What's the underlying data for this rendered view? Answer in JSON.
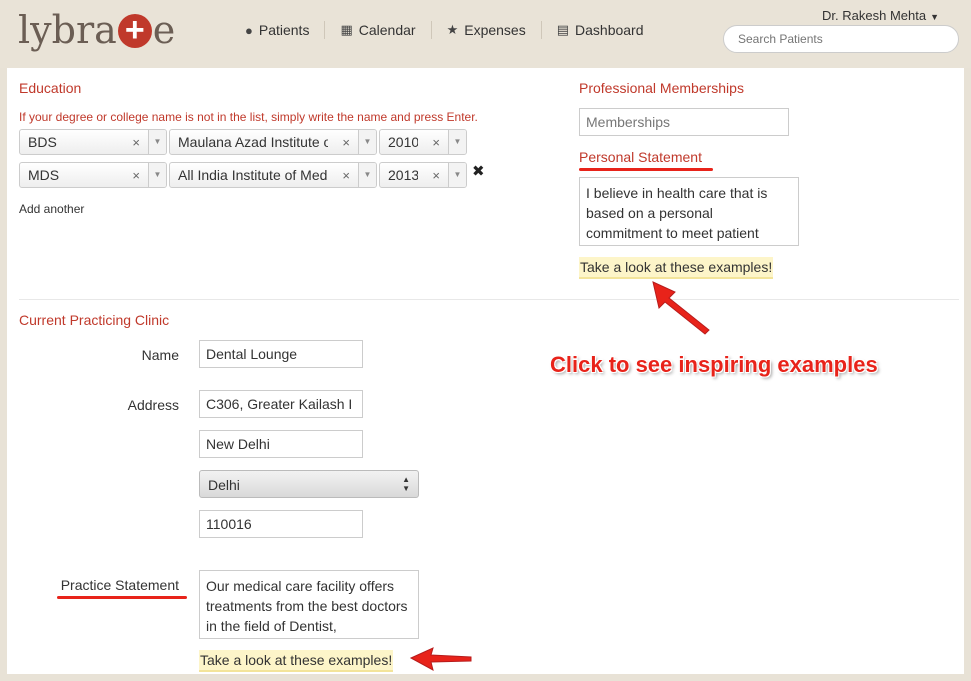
{
  "header": {
    "logo_left": "lybra",
    "logo_right": "e",
    "nav": [
      {
        "label": "Patients",
        "icon": "user-icon"
      },
      {
        "label": "Calendar",
        "icon": "calendar-icon"
      },
      {
        "label": "Expenses",
        "icon": "star-icon"
      },
      {
        "label": "Dashboard",
        "icon": "bar-chart-icon"
      }
    ],
    "user_name": "Dr. Rakesh Mehta",
    "search_placeholder": "Search Patients"
  },
  "education": {
    "title": "Education",
    "hint": "If your degree or college name is not in the list, simply write the name and press Enter.",
    "rows": [
      {
        "degree": "BDS",
        "college": "Maulana Azad Institute o...",
        "year": "2010"
      },
      {
        "degree": "MDS",
        "college": "All India Institute of Medi...",
        "year": "2013"
      }
    ],
    "add_another": "Add another"
  },
  "memberships": {
    "title": "Professional Memberships",
    "placeholder": "Memberships"
  },
  "personal_statement": {
    "title": "Personal Statement",
    "text": "I believe in health care that is based on a personal commitment to meet patient",
    "examples_link": "Take a look at these examples!"
  },
  "clinic": {
    "title": "Current Practicing Clinic",
    "name_label": "Name",
    "name_value": "Dental Lounge",
    "address_label": "Address",
    "address_line": "C306, Greater Kailash I",
    "city": "New Delhi",
    "state": "Delhi",
    "pincode": "110016",
    "practice_label": "Practice Statement",
    "practice_text": "Our medical care facility offers treatments from the best doctors in the field of Dentist,",
    "examples_link": "Take a look at these examples!"
  },
  "callout": "Click to see inspiring examples",
  "colors": {
    "accent": "#c0392b",
    "annotation": "#e8231a",
    "highlight": "#fdf5c9"
  }
}
